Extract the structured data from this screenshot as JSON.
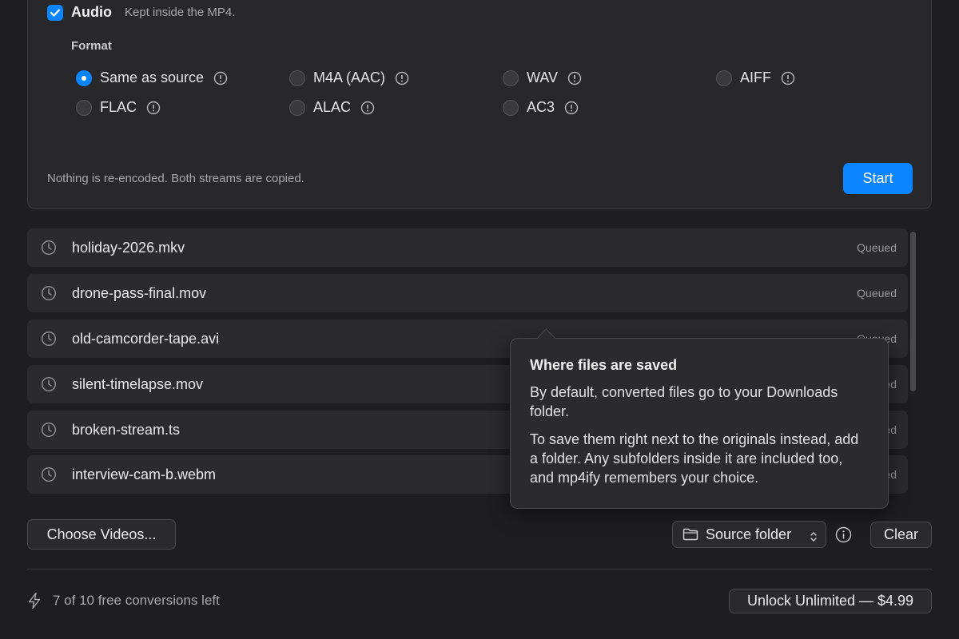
{
  "audio": {
    "title": "Audio",
    "subtitle": "Kept inside the MP4.",
    "checked": true,
    "format_label": "Format",
    "options": [
      {
        "label": "Same as source",
        "selected": true
      },
      {
        "label": "M4A (AAC)",
        "selected": false
      },
      {
        "label": "WAV",
        "selected": false
      },
      {
        "label": "AIFF",
        "selected": false
      },
      {
        "label": "FLAC",
        "selected": false
      },
      {
        "label": "ALAC",
        "selected": false
      },
      {
        "label": "AC3",
        "selected": false
      }
    ],
    "note": "Nothing is re-encoded. Both streams are copied.",
    "start_label": "Start"
  },
  "queue": [
    {
      "name": "holiday-2026.mkv",
      "status": "Queued"
    },
    {
      "name": "drone-pass-final.mov",
      "status": "Queued"
    },
    {
      "name": "old-camcorder-tape.avi",
      "status": "Queued"
    },
    {
      "name": "silent-timelapse.mov",
      "status": "Queued"
    },
    {
      "name": "broken-stream.ts",
      "status": "Queued"
    },
    {
      "name": "interview-cam-b.webm",
      "status": "Queued"
    }
  ],
  "tooltip": {
    "title": "Where files are saved",
    "p1": "By default, converted files go to your Downloads folder.",
    "p2": "To save them right next to the originals instead, add a folder. Any subfolders inside it are included too, and mp4ify remembers your choice."
  },
  "toolbar": {
    "choose_label": "Choose Videos...",
    "destination_label": "Source folder",
    "clear_label": "Clear"
  },
  "footer": {
    "free_left": "7 of 10 free conversions left",
    "unlock_label": "Unlock Unlimited — $4.99"
  },
  "colors": {
    "accent": "#0a84ff",
    "background": "#1e1e20"
  }
}
